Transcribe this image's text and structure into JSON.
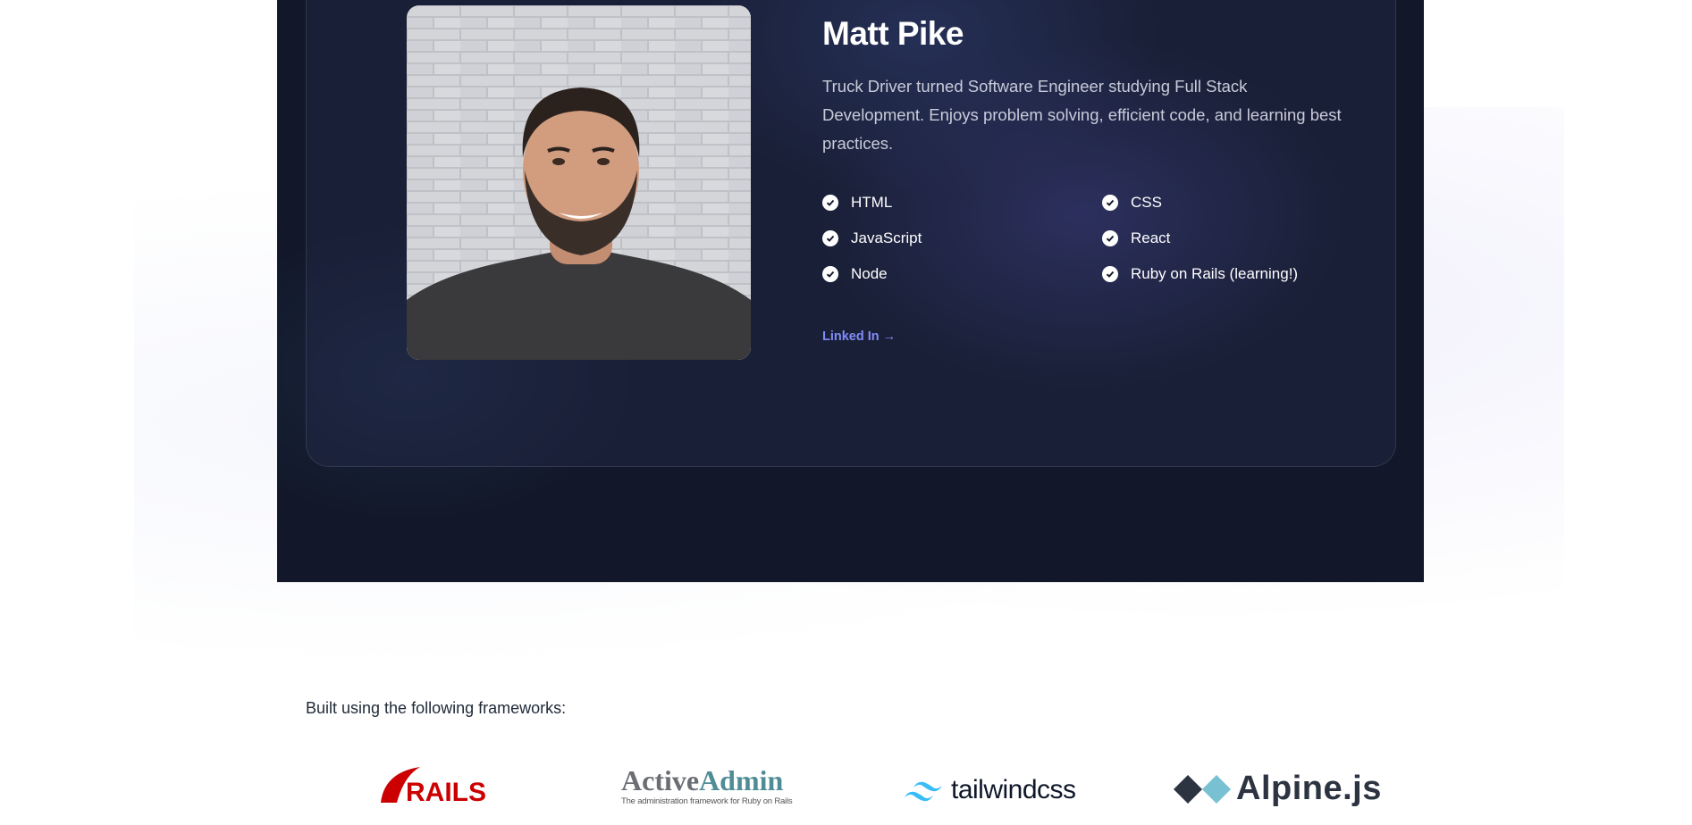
{
  "profile": {
    "name": "Matt Pike",
    "bio": "Truck Driver turned Software Engineer studying Full Stack Development. Enjoys problem solving, efficient code, and learning best practices.",
    "skills": [
      "HTML",
      "CSS",
      "JavaScript",
      "React",
      "Node",
      "Ruby on Rails (learning!)"
    ],
    "link_label": "Linked In →"
  },
  "frameworks": {
    "heading": "Built using the following frameworks:",
    "logos": [
      {
        "name": "Rails",
        "text": "RAILS",
        "color": "#cc0000"
      },
      {
        "name": "ActiveAdmin",
        "text_a": "Active",
        "text_b": "Admin",
        "tagline": "The administration framework for Ruby on Rails",
        "color_a": "#6b6f73",
        "color_b": "#4e8d96"
      },
      {
        "name": "tailwindcss",
        "text": "tailwindcss",
        "color": "#38bdf8"
      },
      {
        "name": "Alpine.js",
        "text": "Alpine.js",
        "color": "#2d3441",
        "accent": "#77c1d2"
      }
    ]
  },
  "colors": {
    "hero_bg": "#121829",
    "link": "#818cf8",
    "text_light": "#c8cbd9"
  }
}
